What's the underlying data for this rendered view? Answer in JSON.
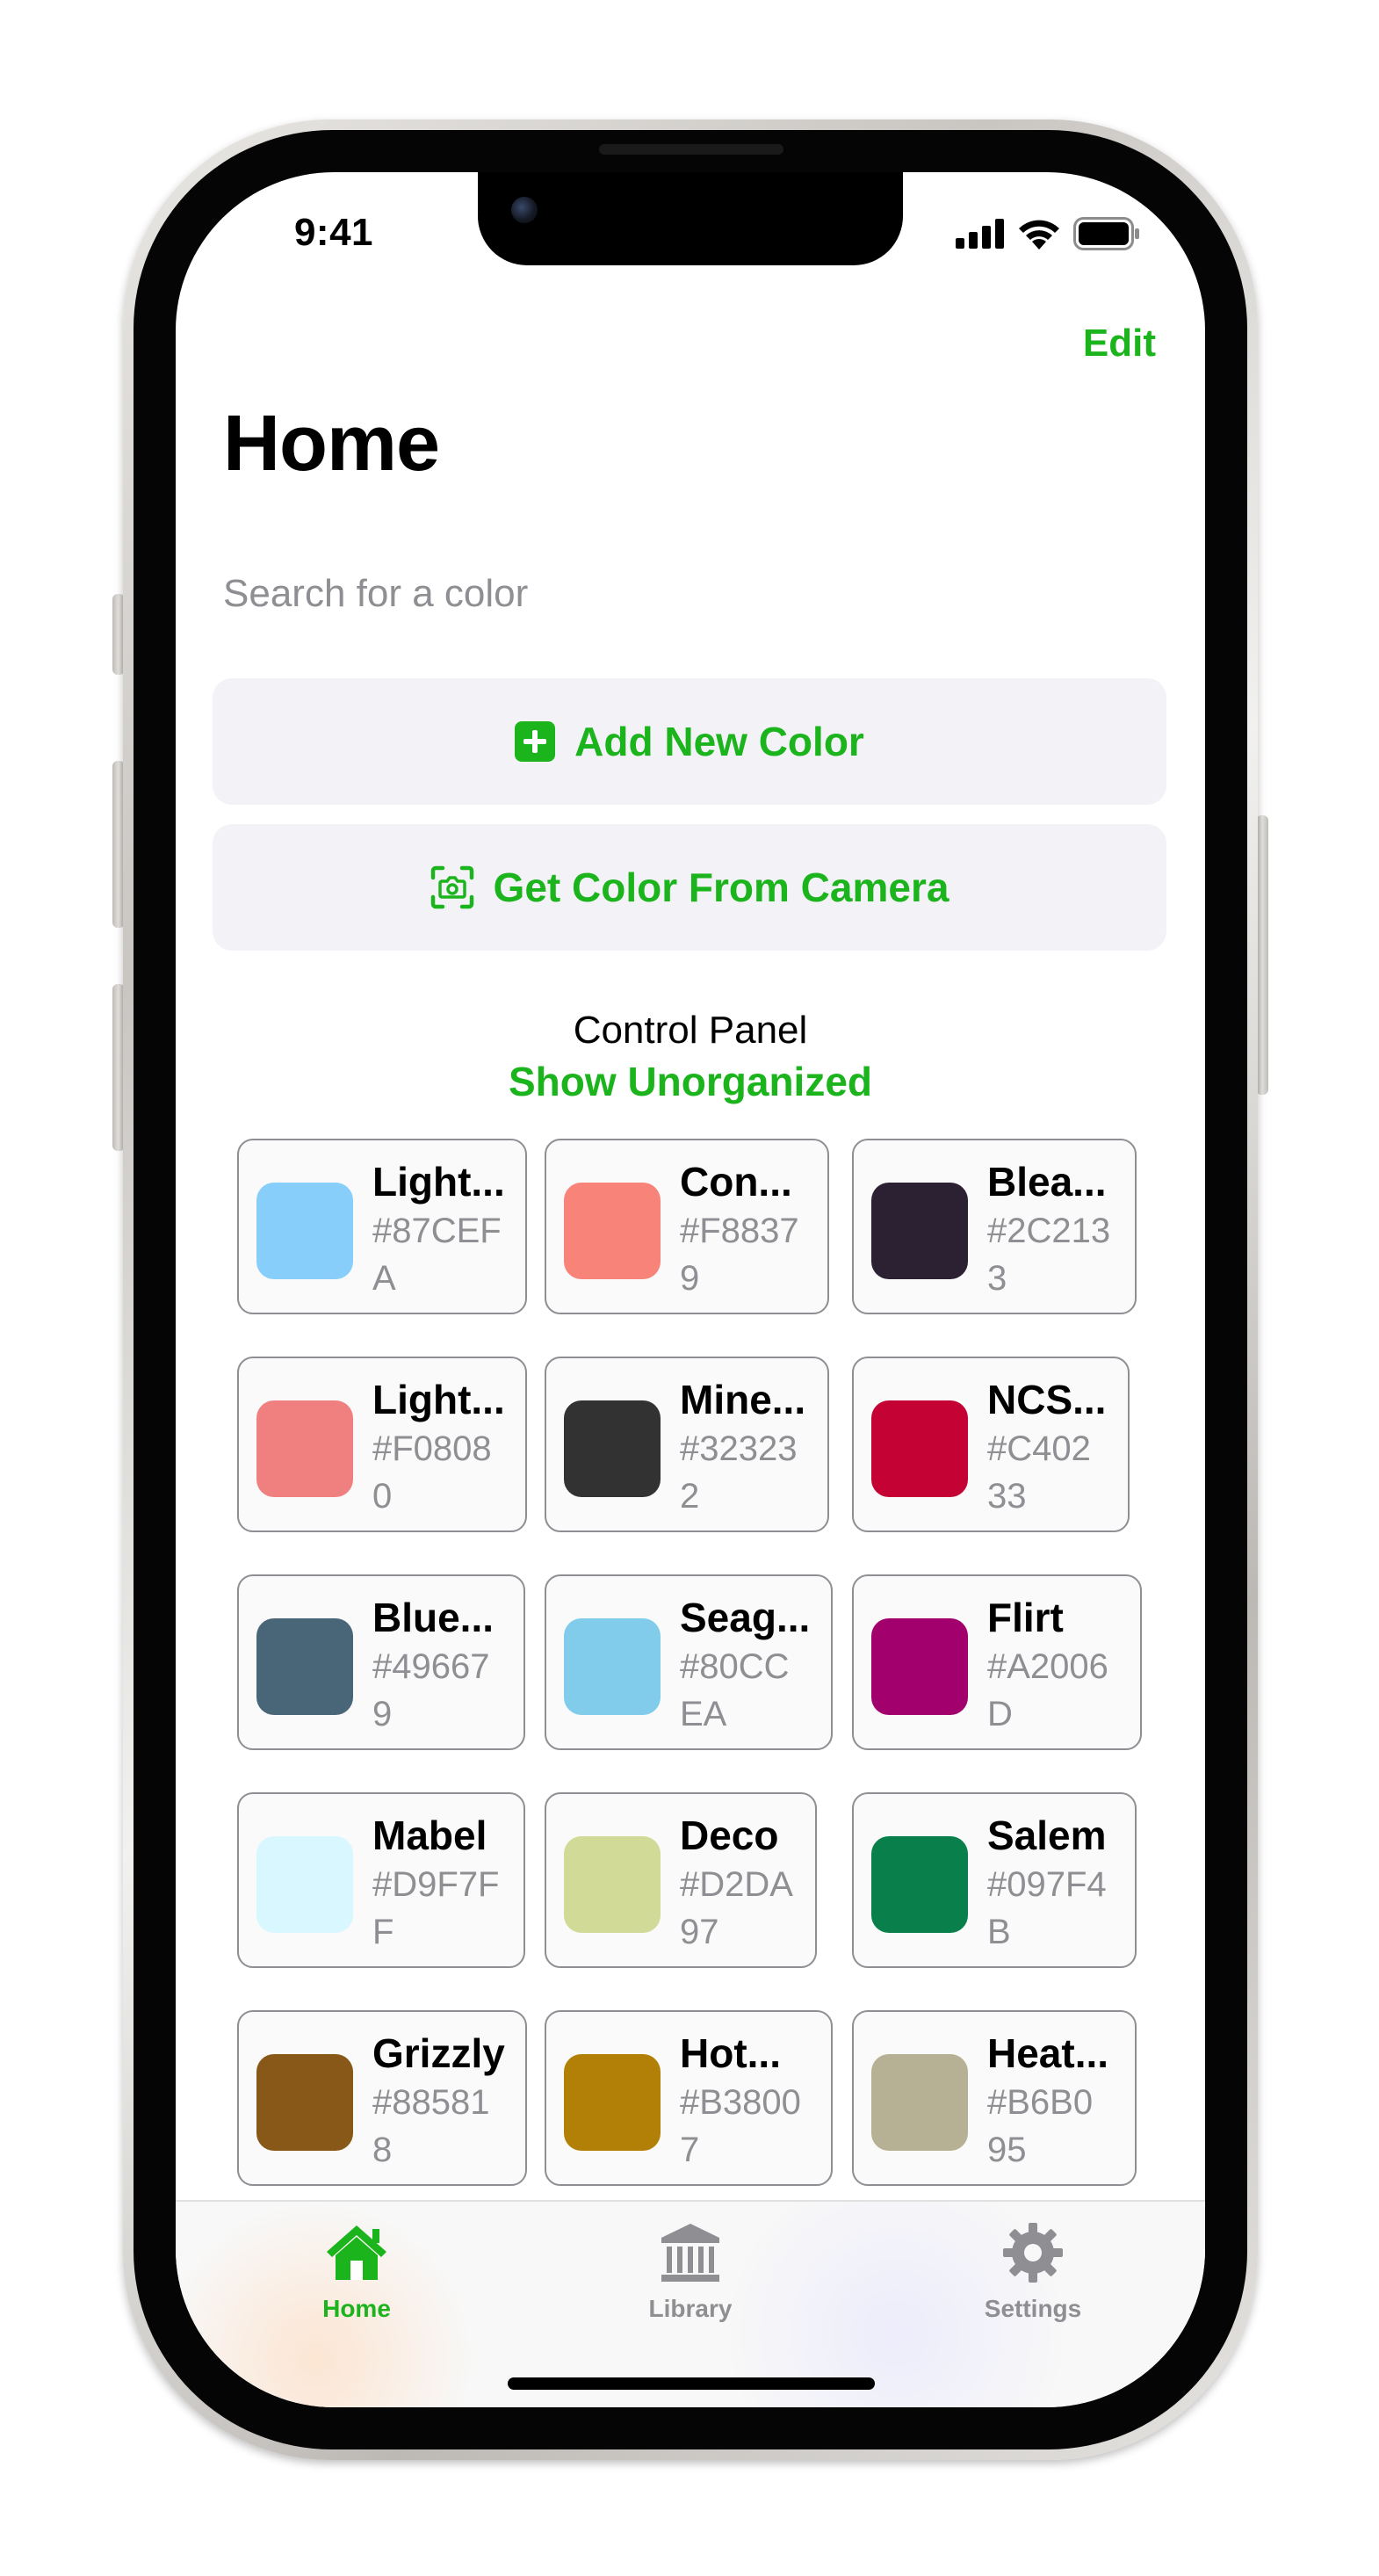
{
  "status_bar": {
    "time": "9:41"
  },
  "nav": {
    "edit_label": "Edit",
    "title": "Home"
  },
  "search": {
    "placeholder": "Search for a color"
  },
  "actions": {
    "add_label": "Add New Color",
    "camera_label": "Get Color From Camera"
  },
  "control_panel": {
    "title": "Control Panel",
    "link": "Show Unorganized"
  },
  "colors": [
    {
      "name": "Light...",
      "hex_lines": [
        "#87CEF",
        "A"
      ],
      "swatch": "#87CEFA"
    },
    {
      "name": "Con...",
      "hex_lines": [
        "#F8837",
        "9"
      ],
      "swatch": "#F88379"
    },
    {
      "name": "Blea...",
      "hex_lines": [
        "#2C213",
        "3"
      ],
      "swatch": "#2C2133"
    },
    {
      "name": "Light...",
      "hex_lines": [
        "#F0808",
        "0"
      ],
      "swatch": "#F08080"
    },
    {
      "name": "Mine...",
      "hex_lines": [
        "#32323",
        "2"
      ],
      "swatch": "#323232"
    },
    {
      "name": "NCS...",
      "hex_lines": [
        "#C402",
        "33"
      ],
      "swatch": "#C40233"
    },
    {
      "name": "Blue...",
      "hex_lines": [
        "#49667",
        "9"
      ],
      "swatch": "#496679"
    },
    {
      "name": "Seag...",
      "hex_lines": [
        "#80CC",
        "EA"
      ],
      "swatch": "#80CCEA"
    },
    {
      "name": "Flirt",
      "hex_lines": [
        "#A2006",
        "D"
      ],
      "swatch": "#A2006D"
    },
    {
      "name": "Mabel",
      "hex_lines": [
        "#D9F7F",
        "F"
      ],
      "swatch": "#D9F7FF"
    },
    {
      "name": "Deco",
      "hex_lines": [
        "#D2DA",
        "97"
      ],
      "swatch": "#D2DA97"
    },
    {
      "name": "Salem",
      "hex_lines": [
        "#097F4",
        "B"
      ],
      "swatch": "#097F4B"
    },
    {
      "name": "Grizzly",
      "hex_lines": [
        "#88581",
        "8"
      ],
      "swatch": "#885818"
    },
    {
      "name": "Hot...",
      "hex_lines": [
        "#B3800",
        "7"
      ],
      "swatch": "#B38007"
    },
    {
      "name": "Heat...",
      "hex_lines": [
        "#B6B0",
        "95"
      ],
      "swatch": "#B6B095"
    }
  ],
  "tabs": [
    {
      "label": "Home",
      "icon": "house-icon",
      "active": true
    },
    {
      "label": "Library",
      "icon": "bank-icon",
      "active": false
    },
    {
      "label": "Settings",
      "icon": "gear-icon",
      "active": false
    }
  ],
  "theme": {
    "accent": "#1CB41C",
    "inactive": "#8E8E93",
    "button_bg": "#F2F2F7"
  }
}
